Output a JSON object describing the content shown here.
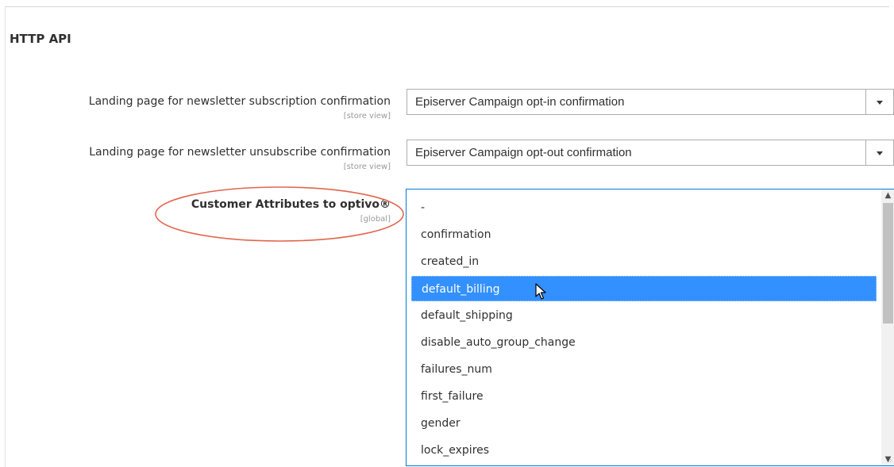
{
  "section": {
    "title": "HTTP API"
  },
  "fields": {
    "subscribe_landing": {
      "label": "Landing page for newsletter subscription confirmation",
      "scope": "[store view]",
      "value": "Episerver Campaign opt-in confirmation"
    },
    "unsubscribe_landing": {
      "label": "Landing page for newsletter unsubscribe confirmation",
      "scope": "[store view]",
      "value": "Episerver Campaign opt-out confirmation"
    },
    "customer_attributes": {
      "label": "Customer Attributes to optivo®",
      "scope": "[global]",
      "options": [
        {
          "label": "-"
        },
        {
          "label": "confirmation"
        },
        {
          "label": "created_in"
        },
        {
          "label": "default_billing",
          "selected": true
        },
        {
          "label": "default_shipping"
        },
        {
          "label": "disable_auto_group_change"
        },
        {
          "label": "failures_num"
        },
        {
          "label": "first_failure"
        },
        {
          "label": "gender"
        },
        {
          "label": "lock_expires"
        }
      ]
    }
  },
  "colors": {
    "selected_option_bg": "#3390ff",
    "focus_border": "#007bdb",
    "annotation_ellipse": "#e2654e"
  },
  "icons": {
    "dropdown": "chevron-down-icon",
    "scroll_up": "scroll-up-icon",
    "scroll_down": "scroll-down-icon",
    "pointer": "mouse-pointer-icon",
    "resize": "resize-grip-icon"
  }
}
